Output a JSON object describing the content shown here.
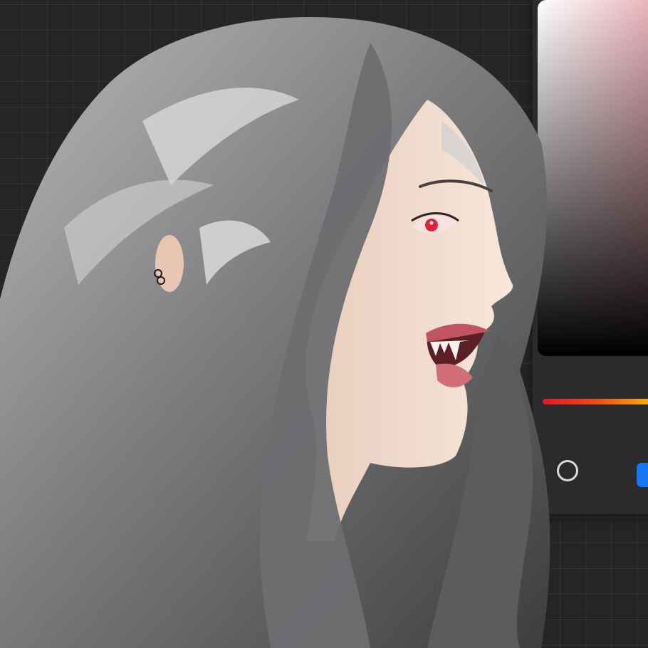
{
  "app": {
    "background_color": "#252525",
    "grid_color": "#333333"
  },
  "color_picker": {
    "base_color": "#e6a3ae",
    "hue_gradient": [
      "#e2182a",
      "#f04a1a",
      "#f6a40f",
      "#f7d40a"
    ],
    "secondary_swatch_color": "#1677f2",
    "icons": {
      "current_color": "circle-ring-icon",
      "palette_swatch": "blue-swatch-icon"
    }
  },
  "artwork": {
    "palette": {
      "hair_dark": "#3b3b3d",
      "hair_mid": "#8a8a8d",
      "hair_light": "#d7d7d9",
      "skin": "#f0dccd",
      "eye": "#e0213a",
      "lips": "#c05560"
    }
  }
}
